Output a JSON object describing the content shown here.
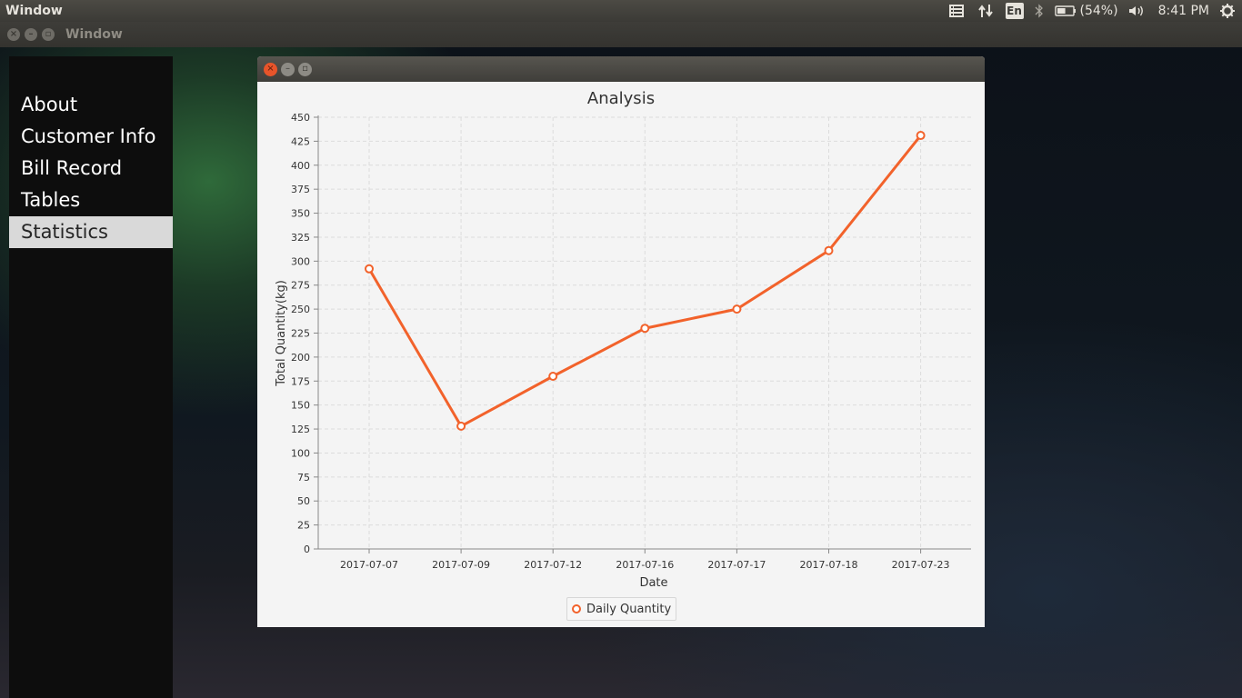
{
  "top_panel": {
    "app_title": "Window",
    "language": "En",
    "battery_text": "(54%)",
    "battery_level": 0.54,
    "time": "8:41 PM"
  },
  "window_bar": {
    "title": "Window"
  },
  "sidebar": {
    "items": [
      {
        "label": "About",
        "active": false
      },
      {
        "label": "Customer Info",
        "active": false
      },
      {
        "label": "Bill Record",
        "active": false
      },
      {
        "label": "Tables",
        "active": false
      },
      {
        "label": "Statistics",
        "active": true
      }
    ]
  },
  "chart_window": {
    "close_glyph": "×",
    "min_glyph": "–",
    "max_glyph": "▫"
  },
  "colors": {
    "series": "#f2622b",
    "grid": "#dcdcdc"
  },
  "chart_data": {
    "type": "line",
    "title": "Analysis",
    "xlabel": "Date",
    "ylabel": "Total Quantity(kg)",
    "categories": [
      "2017-07-07",
      "2017-07-09",
      "2017-07-12",
      "2017-07-16",
      "2017-07-17",
      "2017-07-18",
      "2017-07-23"
    ],
    "series": [
      {
        "name": "Daily Quantity",
        "values": [
          292,
          128,
          180,
          230,
          250,
          311,
          431
        ]
      }
    ],
    "ylim": [
      0,
      450
    ],
    "yticks": [
      0,
      25,
      50,
      75,
      100,
      125,
      150,
      175,
      200,
      225,
      250,
      275,
      300,
      325,
      350,
      375,
      400,
      425,
      450
    ],
    "grid": true,
    "legend": "bottom-center"
  }
}
